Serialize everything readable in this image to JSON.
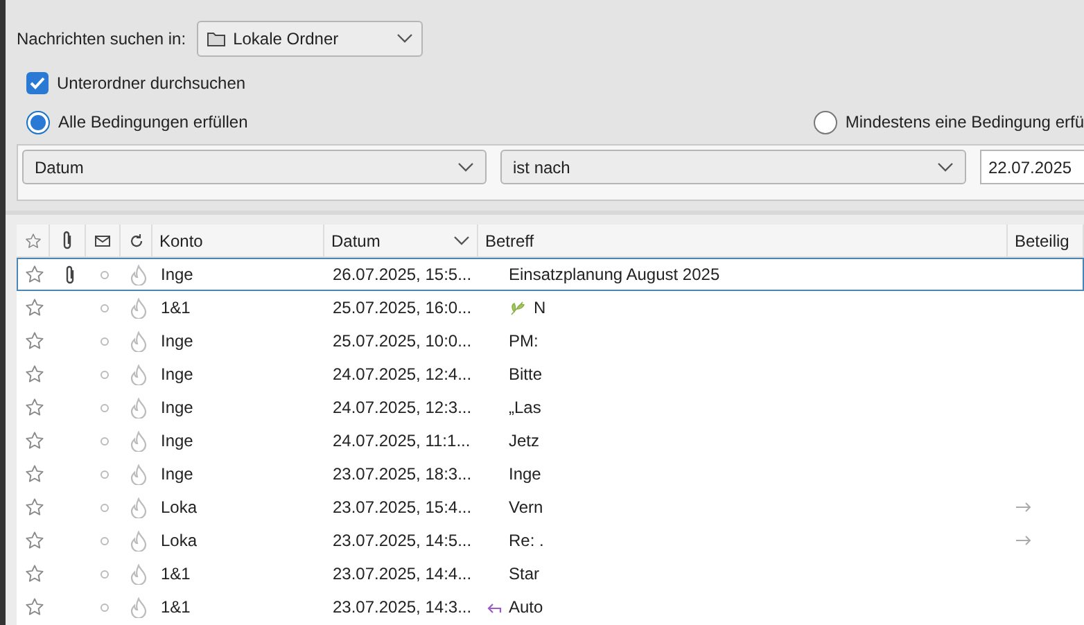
{
  "search_in": {
    "label": "Nachrichten suchen in:",
    "folder": "Lokale Ordner"
  },
  "subfolders": {
    "label": "Unterordner durchsuchen",
    "checked": true
  },
  "match": [
    {
      "label": "Alle Bedingungen erfüllen",
      "selected": true
    },
    {
      "label": "Mindestens eine Bedingung erfü",
      "selected": false
    }
  ],
  "criterion": {
    "field": "Datum",
    "operator": "ist nach",
    "value": "22.07.2025"
  },
  "table": {
    "columns": [
      {
        "kind": "star"
      },
      {
        "kind": "attachment"
      },
      {
        "kind": "read"
      },
      {
        "kind": "junk"
      },
      {
        "kind": "text",
        "label": "Konto"
      },
      {
        "kind": "text",
        "label": "Datum",
        "sorted": true
      },
      {
        "kind": "text",
        "label": "Betreff"
      },
      {
        "kind": "text",
        "label": "Beteilig"
      }
    ],
    "rows": [
      {
        "account": "Inge",
        "date": "26.07.2025, 15:5...",
        "subject": "Einsatzplanung August 2025",
        "attachment": true,
        "selected": true,
        "forwarded": false
      },
      {
        "account": "1&1",
        "date": "25.07.2025, 16:0...",
        "subject": "N",
        "kind": "leaf",
        "attachment": false,
        "selected": false,
        "forwarded": false
      },
      {
        "account": "Inge",
        "date": "25.07.2025, 10:0...",
        "subject": "PM:",
        "attachment": false,
        "selected": false,
        "forwarded": false
      },
      {
        "account": "Inge",
        "date": "24.07.2025, 12:4...",
        "subject": "Bitte",
        "attachment": false,
        "selected": false,
        "forwarded": false
      },
      {
        "account": "Inge",
        "date": "24.07.2025, 12:3...",
        "subject": "„Las",
        "attachment": false,
        "selected": false,
        "forwarded": false
      },
      {
        "account": "Inge",
        "date": "24.07.2025, 11:1...",
        "subject": "Jetz",
        "attachment": false,
        "selected": false,
        "forwarded": false
      },
      {
        "account": "Inge",
        "date": "23.07.2025, 18:3...",
        "subject": "Inge",
        "attachment": false,
        "selected": false,
        "forwarded": false
      },
      {
        "account": "Loka",
        "date": "23.07.2025, 15:4...",
        "subject": "Vern",
        "attachment": false,
        "selected": false,
        "forwarded": true
      },
      {
        "account": "Loka",
        "date": "23.07.2025, 14:5...",
        "subject": "Re: .",
        "attachment": false,
        "selected": false,
        "forwarded": true
      },
      {
        "account": "1&1",
        "date": "23.07.2025, 14:4...",
        "subject": "Star",
        "attachment": false,
        "selected": false,
        "forwarded": false
      },
      {
        "account": "1&1",
        "date": "23.07.2025, 14:3...",
        "subject": "Auto",
        "kind": "reply",
        "attachment": false,
        "selected": false,
        "forwarded": false
      }
    ]
  }
}
